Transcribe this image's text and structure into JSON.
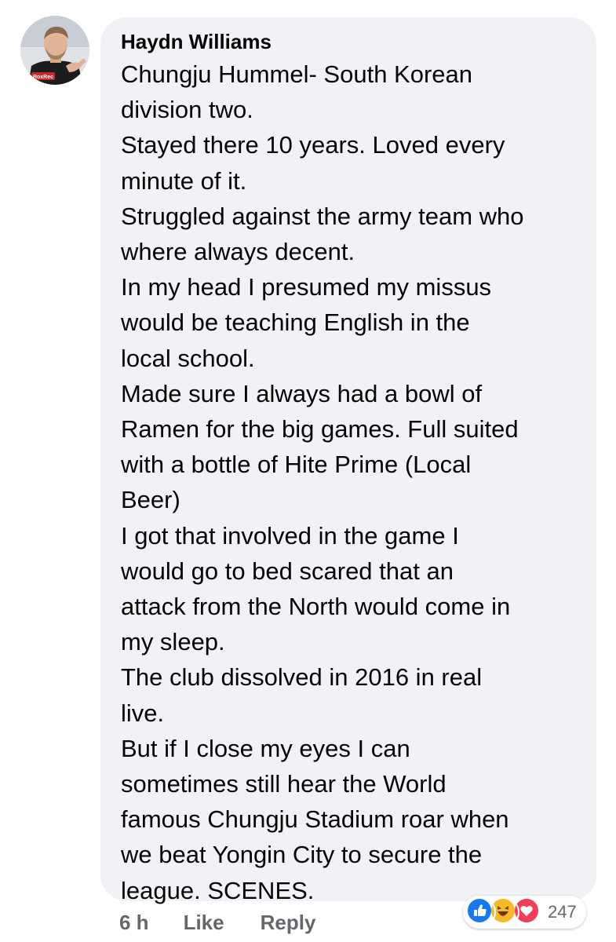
{
  "comment": {
    "author": "Haydn Williams",
    "avatar_shirt_text": "RoxRec",
    "lines": [
      "Chungju Hummel- South Korean",
      "division two.",
      "Stayed there 10 years. Loved every",
      "minute of it.",
      "Struggled against the army team who",
      "where always decent.",
      "In my head I presumed my missus",
      "would be teaching English in the",
      "local school.",
      "Made sure I always had a bowl of",
      "Ramen for the big games. Full suited",
      "with a bottle of Hite Prime (Local",
      "Beer)",
      "I got that involved in the game I",
      "would go to bed scared that an",
      "attack from the North would come in",
      "my sleep.",
      "The club dissolved in 2016 in real",
      "live.",
      "But if I close my eyes I can",
      "sometimes still hear the World",
      "famous Chungju Stadium roar when",
      "we beat Yongin City to secure the",
      "league. SCENES."
    ]
  },
  "actions": {
    "time": "6 h",
    "like_label": "Like",
    "reply_label": "Reply"
  },
  "reactions": {
    "icons": [
      "like-icon",
      "haha-icon",
      "love-icon"
    ],
    "count": "247"
  },
  "colors": {
    "bubble": "#f0f2f5",
    "text": "#050505",
    "meta": "#65676b",
    "like_blue": "#1877f2",
    "love_red": "#f33e58",
    "haha_yellow": "#f7b928"
  }
}
